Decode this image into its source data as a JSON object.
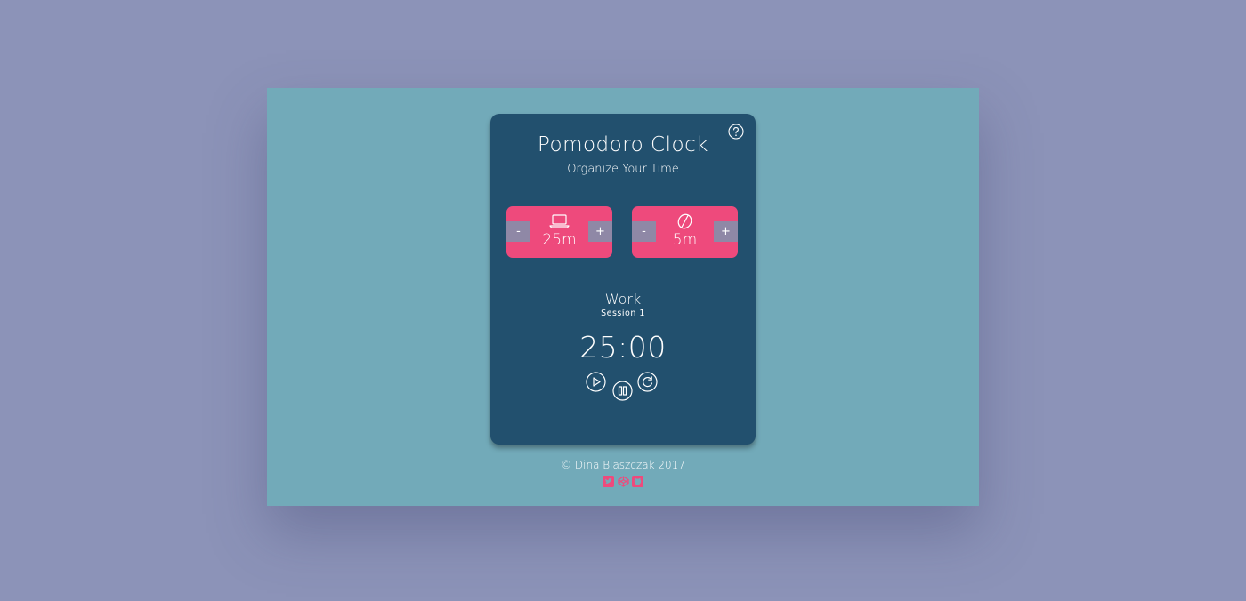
{
  "app": {
    "title": "Pomodoro Clock",
    "subtitle": "Organize Your Time"
  },
  "help": {
    "icon": "help-circle-icon"
  },
  "work_setter": {
    "icon": "laptop-icon",
    "minus_label": "-",
    "plus_label": "+",
    "value": "25m"
  },
  "break_setter": {
    "icon": "coffee-bean-icon",
    "minus_label": "-",
    "plus_label": "+",
    "value": "5m"
  },
  "timer": {
    "mode": "Work",
    "session": "Session 1",
    "time": "25:00"
  },
  "controls": {
    "play_icon": "play-icon",
    "pause_icon": "pause-icon",
    "reset_icon": "reset-icon"
  },
  "footer": {
    "copyright": "© Dina Blaszczak 2017",
    "social": [
      "twitter-icon",
      "codepen-icon",
      "github-icon"
    ]
  },
  "colors": {
    "page_background": "#8c93b8",
    "stage_background": "#72aab9",
    "card_background": "#22506e",
    "accent_pink": "#ee4a7c",
    "stepper_gray": "#8f88a6"
  }
}
